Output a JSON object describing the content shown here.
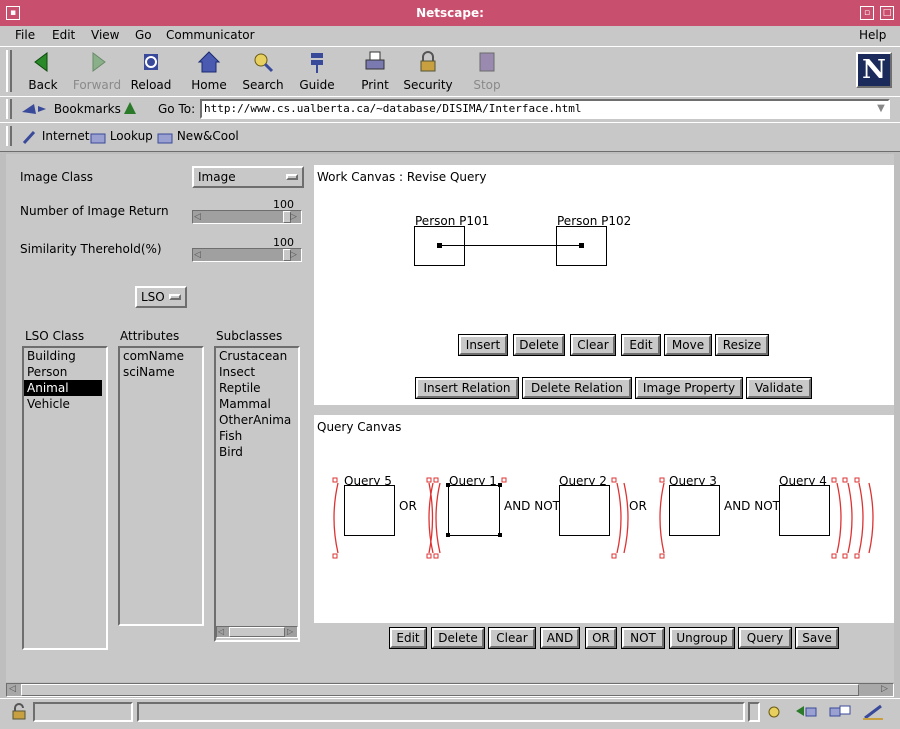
{
  "window": {
    "title": "Netscape:"
  },
  "menu": [
    "File",
    "Edit",
    "View",
    "Go",
    "Communicator",
    "Help"
  ],
  "toolbar": [
    {
      "label": "Back",
      "icon": "back-arrow-icon",
      "enabled": true
    },
    {
      "label": "Forward",
      "icon": "forward-arrow-icon",
      "enabled": false
    },
    {
      "label": "Reload",
      "icon": "reload-icon",
      "enabled": true
    },
    {
      "label": "Home",
      "icon": "home-icon",
      "enabled": true
    },
    {
      "label": "Search",
      "icon": "search-icon",
      "enabled": true
    },
    {
      "label": "Guide",
      "icon": "guide-icon",
      "enabled": true
    },
    {
      "label": "Print",
      "icon": "print-icon",
      "enabled": true
    },
    {
      "label": "Security",
      "icon": "lock-icon",
      "enabled": true
    },
    {
      "label": "Stop",
      "icon": "stop-icon",
      "enabled": false
    }
  ],
  "location": {
    "bookmarks_label": "Bookmarks",
    "goto_label": "Go To:",
    "url": "http://www.cs.ualberta.ca/~database/DISIMA/Interface.html"
  },
  "personal_toolbar": [
    "Internet",
    "Lookup",
    "New&Cool"
  ],
  "left_panel": {
    "image_class_label": "Image Class",
    "image_class_value": "Image",
    "num_return_label": "Number of Image Return",
    "num_return_value": "100",
    "similarity_label": "Similarity Therehold(%)",
    "similarity_value": "100",
    "lso_button": "LSO",
    "lso_class_header": "LSO Class",
    "attributes_header": "Attributes",
    "subclasses_header": "Subclasses",
    "lso_classes": [
      "Building",
      "Person",
      "Animal",
      "Vehicle"
    ],
    "lso_selected": "Animal",
    "attributes": [
      "comName",
      "sciName"
    ],
    "subclasses": [
      "Crustacean",
      "Insect",
      "Reptile",
      "Mammal",
      "OtherAnima",
      "Fish",
      "Bird"
    ]
  },
  "work_canvas": {
    "title": "Work Canvas : Revise Query",
    "objects": [
      "Person P101",
      "Person P102"
    ],
    "buttons_row1": [
      "Insert",
      "Delete",
      "Clear",
      "Edit",
      "Move",
      "Resize"
    ],
    "buttons_row2": [
      "Insert Relation",
      "Delete Relation",
      "Image Property",
      "Validate"
    ]
  },
  "query_canvas": {
    "title": "Query Canvas",
    "queries": [
      "Query 5",
      "Query 1",
      "Query 2",
      "Query 3",
      "Query 4"
    ],
    "operators": [
      "OR",
      "AND NOT",
      "OR",
      "AND NOT"
    ],
    "buttons": [
      "Edit",
      "Delete",
      "Clear",
      "AND",
      "OR",
      "NOT",
      "Ungroup",
      "Query",
      "Save"
    ]
  },
  "colors": {
    "titlebar": "#c8506e",
    "paren": "#dd3333",
    "panel": "#c8c8c8"
  }
}
